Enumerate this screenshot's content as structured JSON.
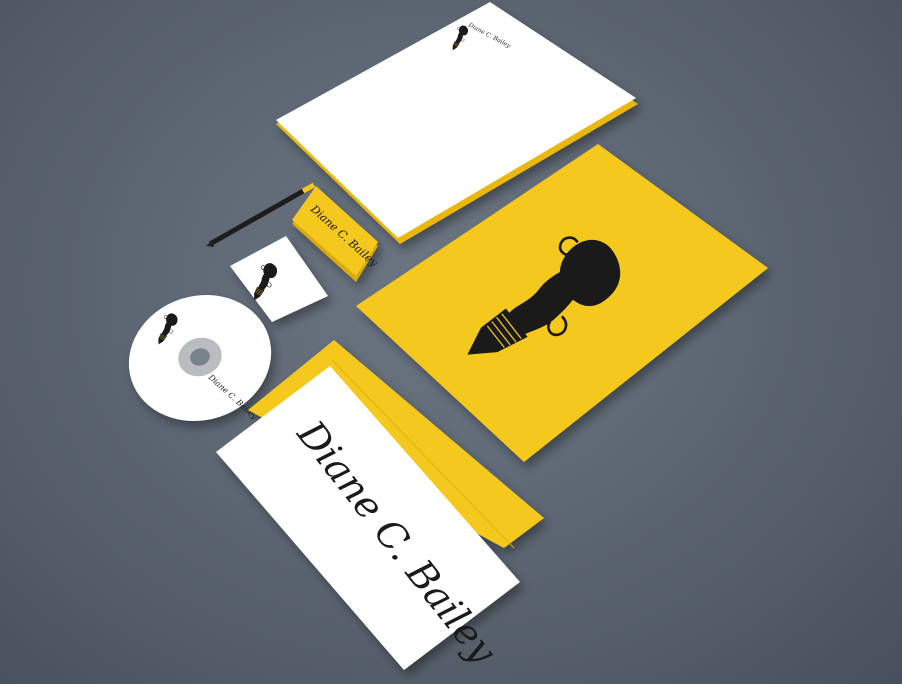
{
  "brand": {
    "signature": "Diane C. Bailey",
    "colors": {
      "background": "#5d6773",
      "accent": "#f4c81a",
      "paper": "#ffffff",
      "ink": "#1a1a1a"
    }
  },
  "items": [
    {
      "name": "letterhead",
      "motif": "silhouette-icon"
    },
    {
      "name": "pencil"
    },
    {
      "name": "business-card-stack",
      "text_ref": "brand.signature"
    },
    {
      "name": "business-card",
      "motif": "silhouette-icon"
    },
    {
      "name": "cd-disc",
      "motif": "silhouette-icon",
      "text_ref": "brand.signature"
    },
    {
      "name": "yellow-folder",
      "motif": "silhouette-icon"
    },
    {
      "name": "envelope",
      "text_ref": "brand.signature"
    }
  ]
}
